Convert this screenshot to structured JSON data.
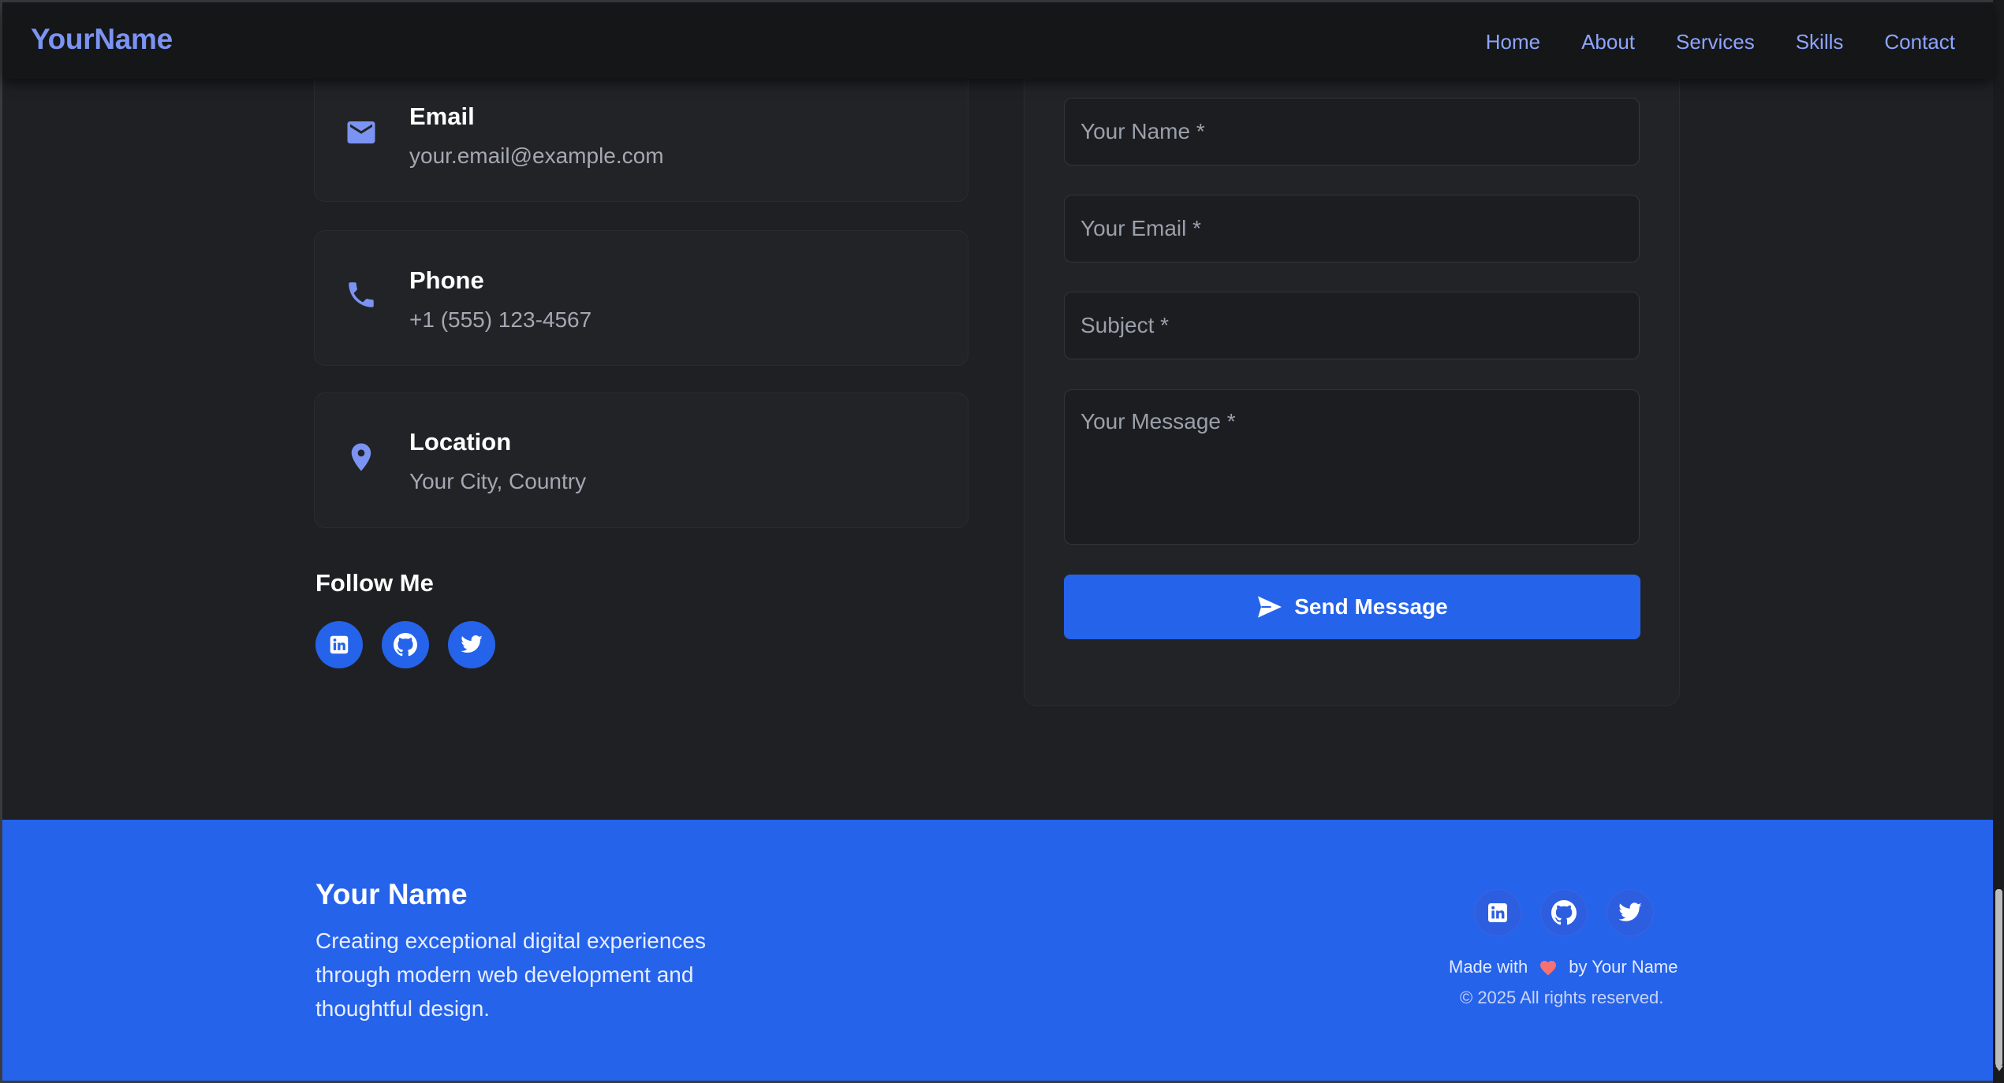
{
  "header": {
    "brand": "YourName",
    "nav": [
      "Home",
      "About",
      "Services",
      "Skills",
      "Contact"
    ]
  },
  "contact_info": {
    "email": {
      "title": "Email",
      "value": "your.email@example.com",
      "icon": "mail-icon"
    },
    "phone": {
      "title": "Phone",
      "value": "+1 (555) 123-4567",
      "icon": "phone-icon"
    },
    "location": {
      "title": "Location",
      "value": "Your City, Country",
      "icon": "location-pin-icon"
    }
  },
  "follow": {
    "title": "Follow Me",
    "icons": [
      "linkedin-icon",
      "github-icon",
      "twitter-icon"
    ]
  },
  "form": {
    "name_placeholder": "Your Name *",
    "email_placeholder": "Your Email *",
    "subject_placeholder": "Subject *",
    "message_placeholder": "Your Message *",
    "send_label": "Send Message"
  },
  "footer": {
    "name": "Your Name",
    "description": "Creating exceptional digital experiences through modern web development and thoughtful design.",
    "made_with_prefix": "Made with",
    "made_with_suffix": "by Your Name",
    "copyright": "© 2025 All rights reserved."
  },
  "colors": {
    "accent": "#2563eb",
    "brand_text": "#7b93f2",
    "background": "#1f2023",
    "card": "#222326",
    "heart": "#f87171"
  }
}
